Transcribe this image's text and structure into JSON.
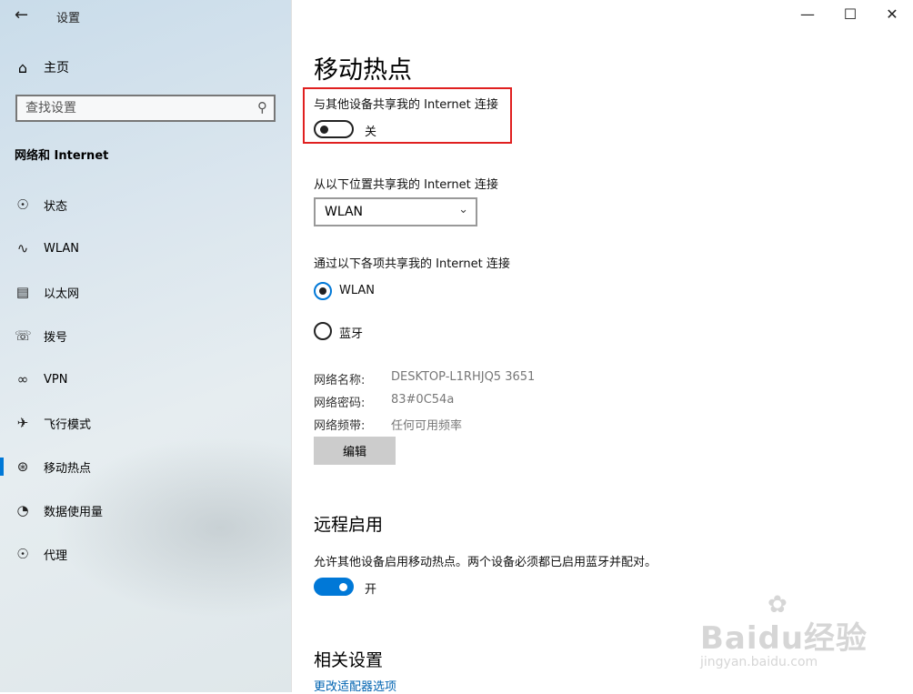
{
  "window": {
    "title": "设置",
    "minimize_icon": "minimize-icon",
    "maximize_icon": "maximize-icon",
    "close_icon": "close-icon"
  },
  "sidebar": {
    "home_label": "主页",
    "search": {
      "placeholder": "查找设置"
    },
    "section_title": "网络和 Internet",
    "items": [
      {
        "label": "状态",
        "icon": "globe-status-icon"
      },
      {
        "label": "WLAN",
        "icon": "wifi-icon"
      },
      {
        "label": "以太网",
        "icon": "ethernet-icon"
      },
      {
        "label": "拨号",
        "icon": "dialup-icon"
      },
      {
        "label": "VPN",
        "icon": "vpn-icon"
      },
      {
        "label": "飞行模式",
        "icon": "airplane-icon"
      },
      {
        "label": "移动热点",
        "icon": "hotspot-icon",
        "active": true
      },
      {
        "label": "数据使用量",
        "icon": "data-usage-icon"
      },
      {
        "label": "代理",
        "icon": "globe-proxy-icon"
      }
    ]
  },
  "main": {
    "title": "移动热点",
    "share": {
      "label": "与其他设备共享我的 Internet 连接",
      "state": "关",
      "on": false
    },
    "share_from": {
      "label": "从以下位置共享我的 Internet 连接",
      "selected": "WLAN"
    },
    "share_over": {
      "label": "通过以下各项共享我的 Internet 连接",
      "options": [
        "WLAN",
        "蓝牙"
      ],
      "selected": "WLAN"
    },
    "network": {
      "name_key": "网络名称:",
      "name_val": "DESKTOP-L1RHJQ5 3651",
      "pass_key": "网络密码:",
      "pass_val": "83#0C54a",
      "band_key": "网络频带:",
      "band_val": "任何可用频率"
    },
    "edit_label": "编辑",
    "remote": {
      "title": "远程启用",
      "desc": "允许其他设备启用移动热点。两个设备必须都已启用蓝牙并配对。",
      "state": "开",
      "on": true
    },
    "related": {
      "title": "相关设置",
      "link": "更改适配器选项"
    }
  },
  "watermark": {
    "brand": "Baidu经验",
    "url": "jingyan.baidu.com"
  },
  "colors": {
    "accent": "#0078d7",
    "highlight_box": "#e02020",
    "link": "#0063b1"
  }
}
